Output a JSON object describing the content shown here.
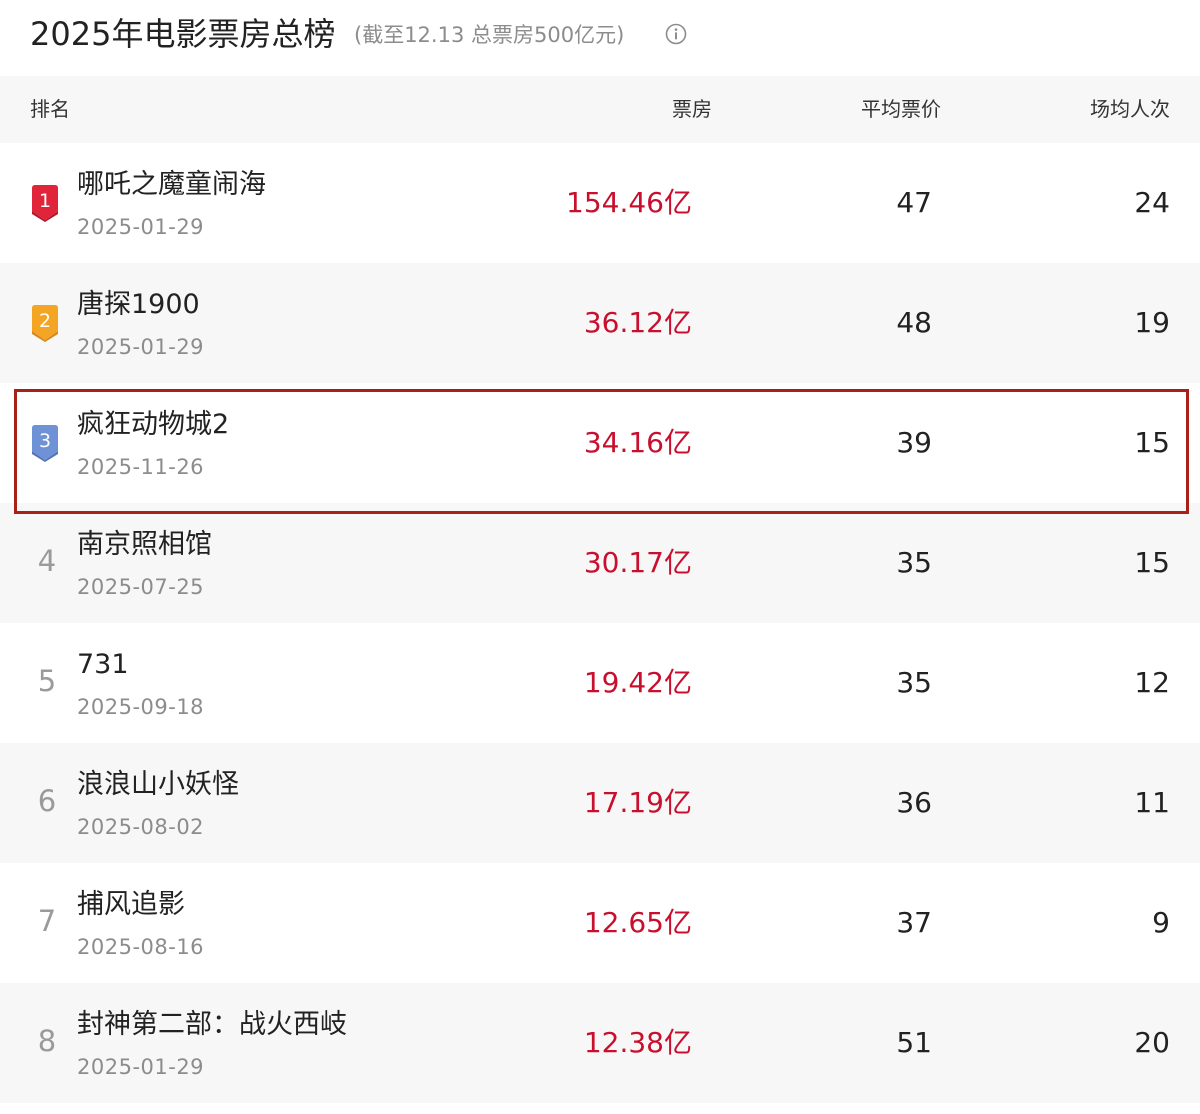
{
  "header": {
    "title": "2025年电影票房总榜",
    "subtitle": "(截至12.13  总票房500亿元)",
    "info_icon": "info-circle-icon"
  },
  "table": {
    "columns": {
      "rank": "排名",
      "box_office": "票房",
      "avg_price": "平均票价",
      "avg_attendance": "场均人次"
    },
    "rows": [
      {
        "rank": "1",
        "name": "哪吒之魔童闹海",
        "date": "2025-01-29",
        "box_office": "154.46亿",
        "avg_price": "47",
        "avg_attendance": "24",
        "badge": "red-medal-icon"
      },
      {
        "rank": "2",
        "name": "唐探1900",
        "date": "2025-01-29",
        "box_office": "36.12亿",
        "avg_price": "48",
        "avg_attendance": "19",
        "badge": "orange-medal-icon"
      },
      {
        "rank": "3",
        "name": "疯狂动物城2",
        "date": "2025-11-26",
        "box_office": "34.16亿",
        "avg_price": "39",
        "avg_attendance": "15",
        "badge": "blue-medal-icon"
      },
      {
        "rank": "4",
        "name": "南京照相馆",
        "date": "2025-07-25",
        "box_office": "30.17亿",
        "avg_price": "35",
        "avg_attendance": "15"
      },
      {
        "rank": "5",
        "name": "731",
        "date": "2025-09-18",
        "box_office": "19.42亿",
        "avg_price": "35",
        "avg_attendance": "12"
      },
      {
        "rank": "6",
        "name": "浪浪山小妖怪",
        "date": "2025-08-02",
        "box_office": "17.19亿",
        "avg_price": "36",
        "avg_attendance": "11"
      },
      {
        "rank": "7",
        "name": "捕风追影",
        "date": "2025-08-16",
        "box_office": "12.65亿",
        "avg_price": "37",
        "avg_attendance": "9"
      },
      {
        "rank": "8",
        "name": "封神第二部：战火西岐",
        "date": "2025-01-29",
        "box_office": "12.38亿",
        "avg_price": "51",
        "avg_attendance": "20"
      }
    ]
  },
  "colors": {
    "box_office_text": "#c8102e",
    "badge_1": "#e0243a",
    "badge_2": "#f5a524",
    "badge_3": "#6f91d6",
    "highlight_border": "#a8201a",
    "row_alt_bg": "#f7f7f7"
  }
}
